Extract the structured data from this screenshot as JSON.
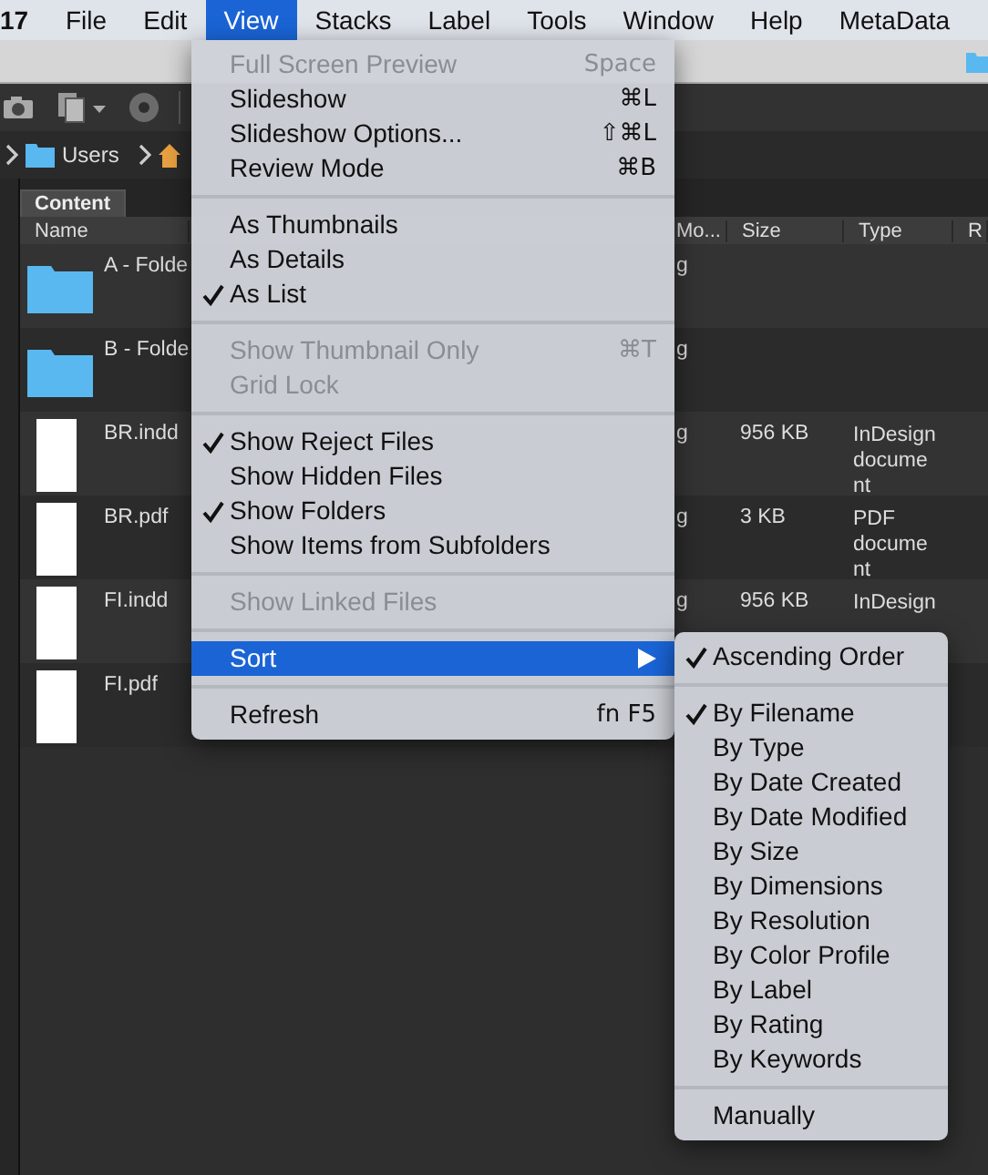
{
  "menu_bar": {
    "app_title": "17",
    "items": [
      {
        "label": "File",
        "selected": false
      },
      {
        "label": "Edit",
        "selected": false
      },
      {
        "label": "View",
        "selected": true
      },
      {
        "label": "Stacks",
        "selected": false
      },
      {
        "label": "Label",
        "selected": false
      },
      {
        "label": "Tools",
        "selected": false
      },
      {
        "label": "Window",
        "selected": false
      },
      {
        "label": "Help",
        "selected": false
      },
      {
        "label": "MetaData",
        "selected": false
      }
    ]
  },
  "path_bar": {
    "items": [
      "Users"
    ]
  },
  "panel_tab": {
    "label": "Content",
    "selected": true
  },
  "table": {
    "columns": [
      "Name",
      "Mo...",
      "Size",
      "Type",
      "R"
    ],
    "rows": [
      {
        "kind": "folder",
        "name": "A - Folde",
        "date": "g"
      },
      {
        "kind": "folder",
        "name": "B - Folde",
        "date": "g"
      },
      {
        "kind": "file",
        "name": "BR.indd",
        "date": "g",
        "size": "956 KB",
        "type": "InDesign document"
      },
      {
        "kind": "file",
        "name": "BR.pdf",
        "date": "g",
        "size": "3 KB",
        "type": "PDF document"
      },
      {
        "kind": "file",
        "name": "FI.indd",
        "date": "g",
        "size": "956 KB",
        "type": "InDesign"
      },
      {
        "kind": "file",
        "name": "FI.pdf"
      }
    ]
  },
  "view_menu": {
    "items": [
      {
        "kind": "item",
        "label": "Full Screen Preview",
        "shortcut": "Space",
        "checked": false,
        "disabled": true,
        "selected": false
      },
      {
        "kind": "item",
        "label": "Slideshow",
        "shortcut": "⌘L",
        "checked": false,
        "disabled": false,
        "selected": false
      },
      {
        "kind": "item",
        "label": "Slideshow Options...",
        "shortcut": "⇧⌘L",
        "checked": false,
        "disabled": false,
        "selected": false
      },
      {
        "kind": "item",
        "label": "Review Mode",
        "shortcut": "⌘B",
        "checked": false,
        "disabled": false,
        "selected": false
      },
      {
        "kind": "separator"
      },
      {
        "kind": "item",
        "label": "As Thumbnails",
        "checked": false,
        "disabled": false,
        "selected": false
      },
      {
        "kind": "item",
        "label": "As Details",
        "checked": false,
        "disabled": false,
        "selected": false
      },
      {
        "kind": "item",
        "label": "As List",
        "checked": true,
        "disabled": false,
        "selected": false
      },
      {
        "kind": "separator"
      },
      {
        "kind": "item",
        "label": "Show Thumbnail Only",
        "shortcut": "⌘T",
        "checked": false,
        "disabled": true,
        "selected": false
      },
      {
        "kind": "item",
        "label": "Grid Lock",
        "checked": false,
        "disabled": true,
        "selected": false
      },
      {
        "kind": "separator"
      },
      {
        "kind": "item",
        "label": "Show Reject Files",
        "checked": true,
        "disabled": false,
        "selected": false
      },
      {
        "kind": "item",
        "label": "Show Hidden Files",
        "checked": false,
        "disabled": false,
        "selected": false
      },
      {
        "kind": "item",
        "label": "Show Folders",
        "checked": true,
        "disabled": false,
        "selected": false
      },
      {
        "kind": "item",
        "label": "Show Items from Subfolders",
        "checked": false,
        "disabled": false,
        "selected": false
      },
      {
        "kind": "separator"
      },
      {
        "kind": "item",
        "label": "Show Linked Files",
        "checked": false,
        "disabled": true,
        "selected": false
      },
      {
        "kind": "separator"
      },
      {
        "kind": "item",
        "label": "Sort",
        "submenu": true,
        "checked": false,
        "disabled": false,
        "selected": true
      },
      {
        "kind": "separator"
      },
      {
        "kind": "item",
        "label": "Refresh",
        "shortcut": "fn F5",
        "checked": false,
        "disabled": false,
        "selected": false
      }
    ]
  },
  "sort_submenu": {
    "items": [
      {
        "kind": "item",
        "label": "Ascending Order",
        "checked": true
      },
      {
        "kind": "separator"
      },
      {
        "kind": "item",
        "label": "By Filename",
        "checked": true
      },
      {
        "kind": "item",
        "label": "By Type",
        "checked": false
      },
      {
        "kind": "item",
        "label": "By Date Created",
        "checked": false
      },
      {
        "kind": "item",
        "label": "By Date Modified",
        "checked": false
      },
      {
        "kind": "item",
        "label": "By Size",
        "checked": false
      },
      {
        "kind": "item",
        "label": "By Dimensions",
        "checked": false
      },
      {
        "kind": "item",
        "label": "By Resolution",
        "checked": false
      },
      {
        "kind": "item",
        "label": "By Color Profile",
        "checked": false
      },
      {
        "kind": "item",
        "label": "By Label",
        "checked": false
      },
      {
        "kind": "item",
        "label": "By Rating",
        "checked": false
      },
      {
        "kind": "item",
        "label": "By Keywords",
        "checked": false
      },
      {
        "kind": "separator"
      },
      {
        "kind": "item",
        "label": "Manually",
        "checked": false
      }
    ]
  }
}
